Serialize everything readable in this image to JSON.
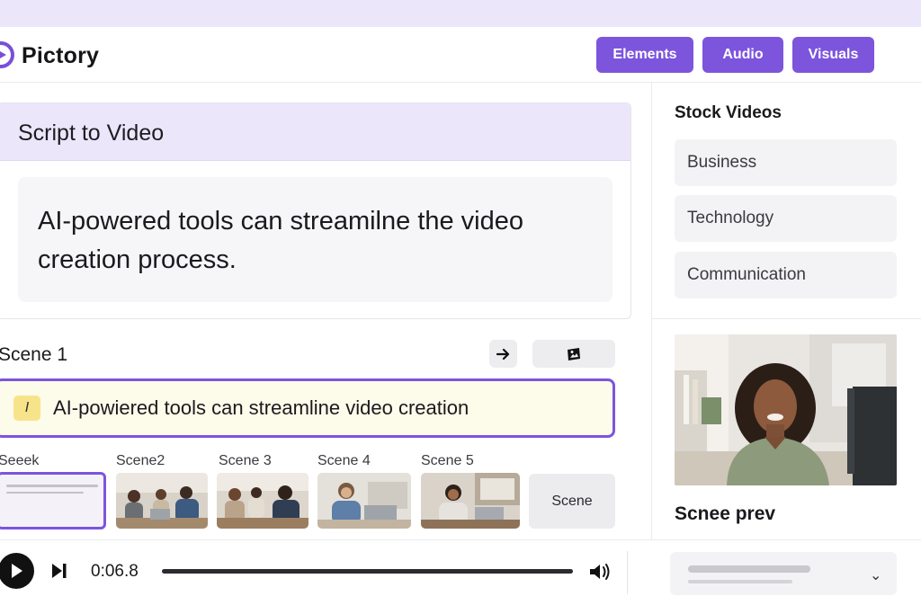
{
  "app": {
    "name": "Pictory"
  },
  "header": {
    "buttons": [
      {
        "label": "Elements"
      },
      {
        "label": "Audio"
      },
      {
        "label": "Visuals"
      }
    ],
    "accent_color": "#7c55dc"
  },
  "editor": {
    "title": "Script to Video",
    "script_text": "AI-powered tools can streamilne the video creation process."
  },
  "sidebar": {
    "stock_title": "Stock Videos",
    "stock_items": [
      {
        "label": "Business"
      },
      {
        "label": "Technology"
      },
      {
        "label": "Communication"
      }
    ],
    "preview_label": "Scnee prev"
  },
  "scene": {
    "label": "Scene 1",
    "caption_chip": "I",
    "caption_text": "AI-powiered tools can streamline video creation"
  },
  "timeline": {
    "thumb_labels": [
      "Seeek",
      "Scene2",
      "Scene 3",
      "Scene 4",
      "Scene 5"
    ],
    "more_label": "Scene"
  },
  "player": {
    "time": "0:06.8",
    "state": "paused"
  }
}
